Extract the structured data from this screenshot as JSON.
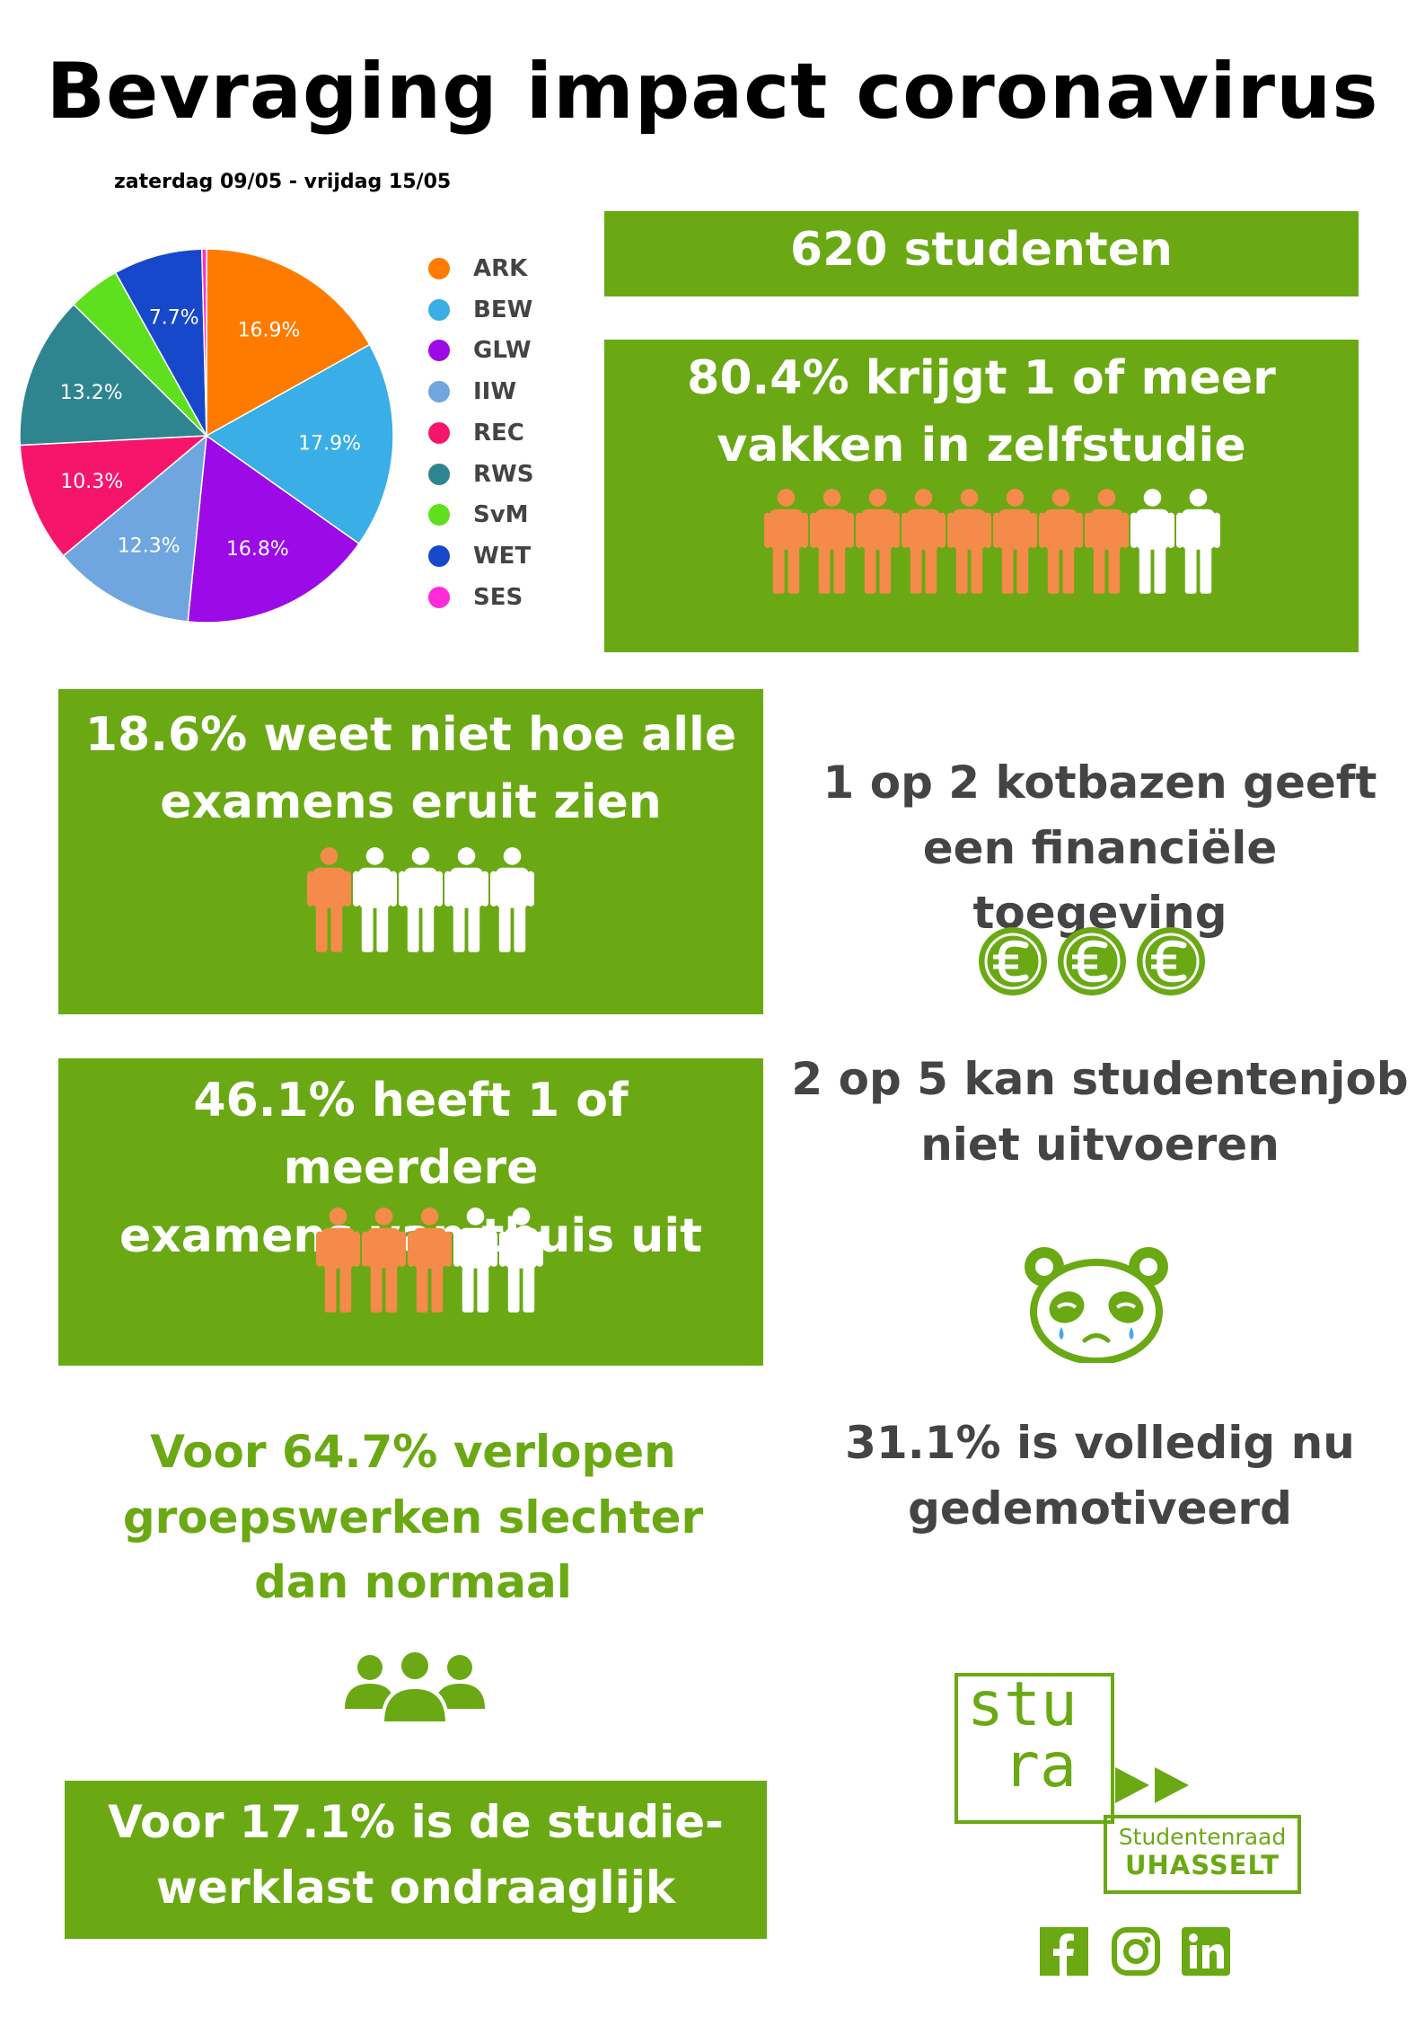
{
  "header": {
    "title": "Bevraging impact coronavirus",
    "period": "zaterdag 09/05 - vrijdag 15/05"
  },
  "chart_data": {
    "type": "pie",
    "categories": [
      "ARK",
      "BEW",
      "GLW",
      "IIW",
      "REC",
      "RWS",
      "SvM",
      "WET",
      "SES"
    ],
    "values": [
      16.9,
      17.9,
      16.8,
      12.3,
      10.3,
      13.2,
      4.5,
      7.7,
      0.4
    ],
    "data_labels": [
      "16.9%",
      "17.9%",
      "16.8%",
      "12.3%",
      "10.3%",
      "13.2%",
      "",
      "7.7%",
      ""
    ],
    "colors": [
      "#ff7b00",
      "#3aaee6",
      "#9c0ae8",
      "#6fa6e0",
      "#f5166b",
      "#2e8590",
      "#5fe01f",
      "#1748cc",
      "#ff2bd9"
    ],
    "legend_position": "right"
  },
  "stats": {
    "students": "620 studenten",
    "self_study": [
      "80.4% krijgt 1 of meer",
      "vakken in zelfstudie"
    ],
    "exams_unknown": [
      "18.6% weet niet hoe alle",
      "examens eruit zien"
    ],
    "landlords": [
      "1 op 2 kotbazen geeft",
      "een financiële toegeving"
    ],
    "exams_home": [
      "46.1% heeft 1 of meerdere",
      "examens van thuis uit"
    ],
    "student_job": [
      "2 op 5 kan studentenjob",
      "niet uitvoeren"
    ],
    "groupwork": [
      "Voor 64.7% verlopen",
      "groepswerken slechter",
      "dan normaal"
    ],
    "demotivated": [
      "31.1% is volledig nu",
      "gedemotiveerd"
    ],
    "workload": [
      "Voor 17.1% is de studie-",
      "werklast ondraaglijk"
    ]
  },
  "icons": {
    "people_self_study": {
      "highlighted": 8,
      "total": 10
    },
    "people_exams_unknown": {
      "highlighted": 1,
      "total": 5
    },
    "people_exams_home": {
      "highlighted": 3,
      "total": 5
    },
    "euro_count": 3,
    "euro_icon": "euro-icon",
    "panda_icon": "sad-panda-icon",
    "group_icon": "group-people-icon",
    "highlight_color": "#f48b4a",
    "normal_color": "#ffffff"
  },
  "logo": {
    "line1": "stu",
    "line2": "ra",
    "sub1": "Studentenraad",
    "sub2": "UHASSELT"
  },
  "social": [
    "facebook-icon",
    "instagram-icon",
    "linkedin-icon"
  ],
  "colors": {
    "green": "#6aa914",
    "dark": "#444444"
  }
}
